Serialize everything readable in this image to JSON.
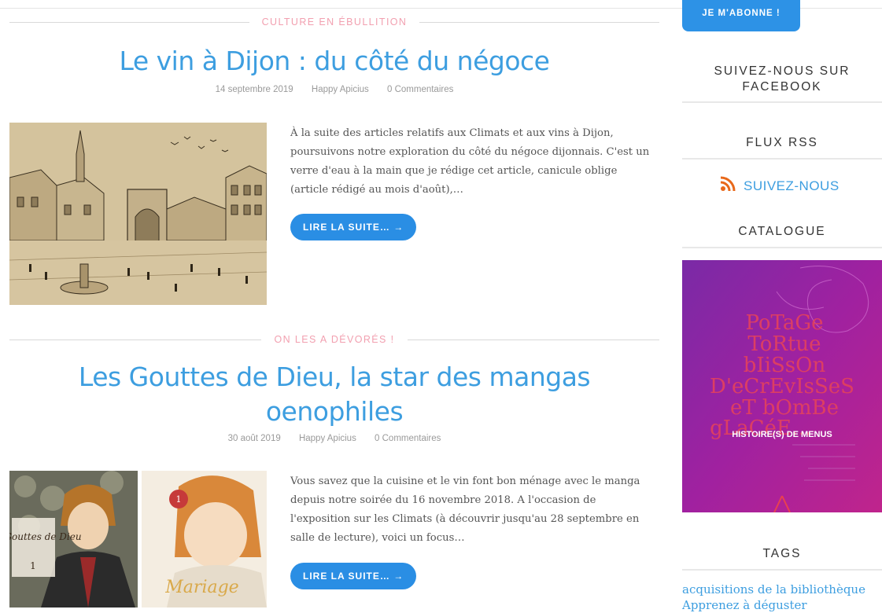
{
  "posts": [
    {
      "category": "CULTURE EN ÉBULLITION",
      "title": "Le vin à Dijon : du côté du négoce",
      "date": "14 septembre 2019",
      "author": "Happy Apicius",
      "comments": "0 Commentaires",
      "excerpt": "À la suite des articles relatifs aux Climats et aux vins à Dijon, poursuivons notre exploration du côté du négoce dijonnais. C'est un verre d'eau à la main que je rédige cet article, canicule oblige (article rédigé au mois d'août),…",
      "button": "LIRE LA SUITE… →"
    },
    {
      "category": "ON LES A DÉVORÉS !",
      "title": "Les Gouttes de Dieu, la star des mangas oenophiles",
      "date": "30 août 2019",
      "author": "Happy Apicius",
      "comments": "0 Commentaires",
      "excerpt": "Vous savez que la cuisine et le vin font bon ménage avec le manga depuis notre soirée du 16 novembre 2018. A l'occasion de l'exposition sur les Climats (à découvrir jusqu'au 28 septembre en salle de lecture), voici un focus…",
      "button": "LIRE LA SUITE… →"
    }
  ],
  "sidebar": {
    "subscribe": "JE M'ABONNE !",
    "facebook_title": "SUIVEZ-NOUS SUR FACEBOOK",
    "rss_title": "FLUX RSS",
    "rss_link": "SUIVEZ-NOUS",
    "catalogue_title": "CATALOGUE",
    "catalogue_cover_text": "HISTOIRE(S) DE MENUS",
    "catalogue_cover_script": [
      "PoTaGe",
      "ToRtue",
      "bIiSsOn",
      "D'eCrEvIsSeS",
      "eT bOmBe",
      "gLaCéE…"
    ],
    "tags_title": "TAGS",
    "tags": [
      "acquisitions de la bibliothèque",
      "Apprenez à déguster"
    ]
  },
  "colors": {
    "accent": "#3d9ee0",
    "button": "#2a8ee4",
    "category": "#f2a0b0"
  },
  "manga_covers": {
    "left_title": "Les Gouttes de Dieu",
    "left_volume": "1",
    "right_title": "Mariage",
    "right_volume": "1"
  }
}
